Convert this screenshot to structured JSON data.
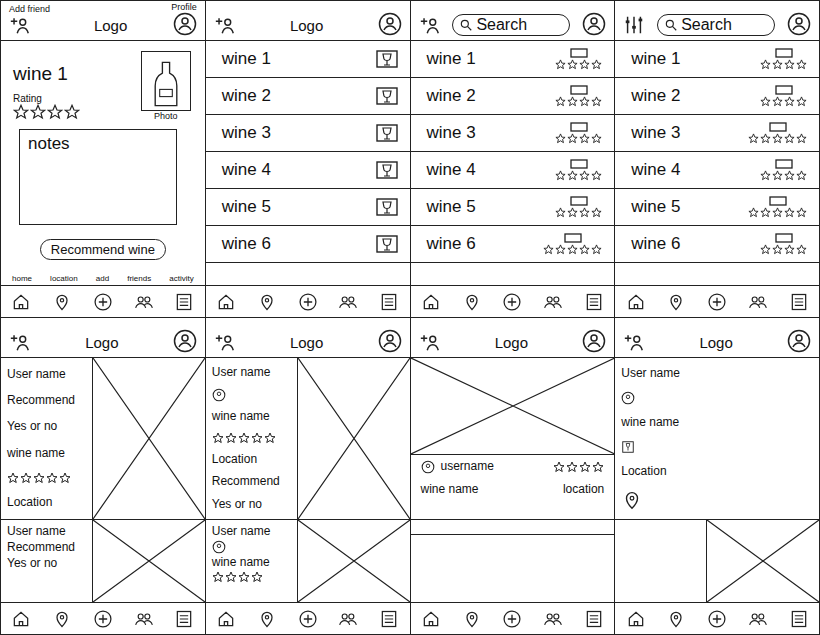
{
  "screens": [
    {
      "kind": "detail",
      "top": {
        "left": "add-friend",
        "center": {
          "kind": "logo",
          "text": "Logo"
        },
        "annotations": {
          "left": "Add friend",
          "right": "Profile"
        }
      },
      "wine": {
        "name": "wine 1",
        "rating_label": "Rating",
        "stars": 4,
        "photo_label": "Photo",
        "notes": "notes",
        "button": "Recommend wine"
      },
      "nav_labels": [
        "home",
        "location",
        "add",
        "friends",
        "activity"
      ]
    },
    {
      "kind": "list-thumb",
      "top": {
        "left": "add-friend",
        "center": {
          "kind": "logo",
          "text": "Logo"
        }
      },
      "rows": [
        {
          "name": "wine 1"
        },
        {
          "name": "wine 2"
        },
        {
          "name": "wine 3"
        },
        {
          "name": "wine 4"
        },
        {
          "name": "wine 5"
        },
        {
          "name": "wine 6"
        }
      ]
    },
    {
      "kind": "list-stars",
      "top": {
        "left": "add-friend",
        "center": {
          "kind": "search",
          "text": "Search"
        }
      },
      "rows": [
        {
          "name": "wine 1",
          "stars": 4
        },
        {
          "name": "wine 2",
          "stars": 4
        },
        {
          "name": "wine 3",
          "stars": 4
        },
        {
          "name": "wine 4",
          "stars": 4
        },
        {
          "name": "wine 5",
          "stars": 4
        },
        {
          "name": "wine 6",
          "stars": 5
        }
      ]
    },
    {
      "kind": "list-stars",
      "top": {
        "left": "filter",
        "center": {
          "kind": "search",
          "text": "Search"
        }
      },
      "rows": [
        {
          "name": "wine 1",
          "stars": 4
        },
        {
          "name": "wine 2",
          "stars": 4
        },
        {
          "name": "wine 3",
          "stars": 5
        },
        {
          "name": "wine 4",
          "stars": 4
        },
        {
          "name": "wine 5",
          "stars": 5
        },
        {
          "name": "wine 6",
          "stars": 4
        }
      ]
    },
    {
      "kind": "feed",
      "top": {
        "left": "add-friend",
        "center": {
          "kind": "logo",
          "text": "Logo"
        }
      },
      "cards": [
        {
          "kind": "side",
          "lines": [
            {
              "kind": "text",
              "text": "User name"
            },
            {
              "kind": "text",
              "text": "Recommend"
            },
            {
              "kind": "text",
              "text": "Yes or no"
            },
            {
              "kind": "text",
              "text": "wine name"
            },
            {
              "kind": "stars",
              "stars": 5
            },
            {
              "kind": "text",
              "text": "Location"
            }
          ]
        },
        {
          "kind": "side",
          "lines": [
            {
              "kind": "text",
              "text": "User name"
            },
            {
              "kind": "text",
              "text": "Recommend"
            },
            {
              "kind": "text",
              "text": "Yes or no"
            }
          ]
        }
      ]
    },
    {
      "kind": "feed",
      "top": {
        "left": "add-friend",
        "center": {
          "kind": "logo",
          "text": "Logo"
        }
      },
      "cards": [
        {
          "kind": "side",
          "lines": [
            {
              "kind": "text",
              "text": "User name"
            },
            {
              "kind": "avatar"
            },
            {
              "kind": "text",
              "text": "wine name"
            },
            {
              "kind": "stars",
              "stars": 5
            },
            {
              "kind": "text",
              "text": "Location"
            },
            {
              "kind": "text",
              "text": "Recommend"
            },
            {
              "kind": "text",
              "text": "Yes or no"
            }
          ]
        },
        {
          "kind": "side",
          "lines": [
            {
              "kind": "text",
              "text": "User name"
            },
            {
              "kind": "avatar"
            },
            {
              "kind": "text",
              "text": "wine name"
            },
            {
              "kind": "stars",
              "stars": 4
            }
          ]
        }
      ]
    },
    {
      "kind": "feed",
      "top": {
        "left": "add-friend",
        "center": {
          "kind": "logo",
          "text": "Logo"
        }
      },
      "cards": [
        {
          "kind": "stacked",
          "username": "username",
          "stars": 4,
          "wine_name": "wine name",
          "location": "location"
        },
        {
          "kind": "blank"
        }
      ]
    },
    {
      "kind": "feed",
      "top": {
        "left": "add-friend",
        "center": {
          "kind": "logo",
          "text": "Logo"
        }
      },
      "cards": [
        {
          "kind": "text",
          "lines": [
            {
              "kind": "text",
              "text": "User name"
            },
            {
              "kind": "avatar"
            },
            {
              "kind": "text",
              "text": "wine name"
            },
            {
              "kind": "wine-icon"
            },
            {
              "kind": "text",
              "text": "Location"
            },
            {
              "kind": "location-icon"
            }
          ]
        },
        {
          "kind": "side",
          "lines": []
        }
      ]
    }
  ]
}
